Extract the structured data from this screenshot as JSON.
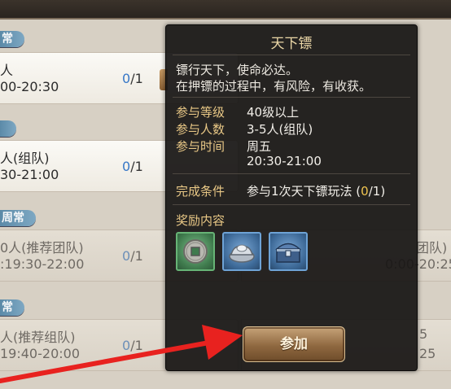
{
  "left_list": {
    "tags": [
      "常",
      "",
      "周常",
      "常"
    ],
    "cards": [
      {
        "line1": "人",
        "line2": "00-20:30",
        "done": "0",
        "total": "/1"
      },
      {
        "line1": "人(组队)",
        "line2": "30-21:00",
        "done": "0",
        "total": "/1"
      },
      {
        "line1": "0人(推荐团队)",
        "line2": ":19:30-22:00",
        "done": "0",
        "total": "/1"
      },
      {
        "line1": "人(推荐组队)",
        "line2": "19:40-20:00",
        "done": "0",
        "total": "/1"
      }
    ],
    "right_fragments": [
      {
        "line1": "团队)",
        "line2": "0:00-20:25"
      },
      {
        "line1": "5",
        "line2": "25"
      }
    ]
  },
  "panel": {
    "title": "天下镖",
    "desc_1": "镖行天下，使命必达。",
    "desc_2": "在押镖的过程中，有风险，有收获。",
    "level_label": "参与等级",
    "level_value": "40级以上",
    "people_label": "参与人数",
    "people_value": "3-5人(组队)",
    "time_label": "参与时间",
    "time_day": "周五",
    "time_range": "20:30-21:00",
    "cond_label": "完成条件",
    "cond_text": "参与1次天下镖玩法 (",
    "cond_done": "0",
    "cond_rest": "/1)",
    "reward_label": "奖励内容",
    "rewards": [
      {
        "icon": "copper-coin-icon",
        "frame": "green"
      },
      {
        "icon": "silver-ingot-icon",
        "frame": "blue"
      },
      {
        "icon": "treasure-chest-icon",
        "frame": "blue"
      }
    ],
    "join_label": "参加"
  },
  "colors": {
    "panel_bg": "#181614",
    "label_gold": "#e9c886",
    "highlight": "#f0c450",
    "progress_blue": "#3677c7",
    "arrow_red": "#e8221f"
  }
}
